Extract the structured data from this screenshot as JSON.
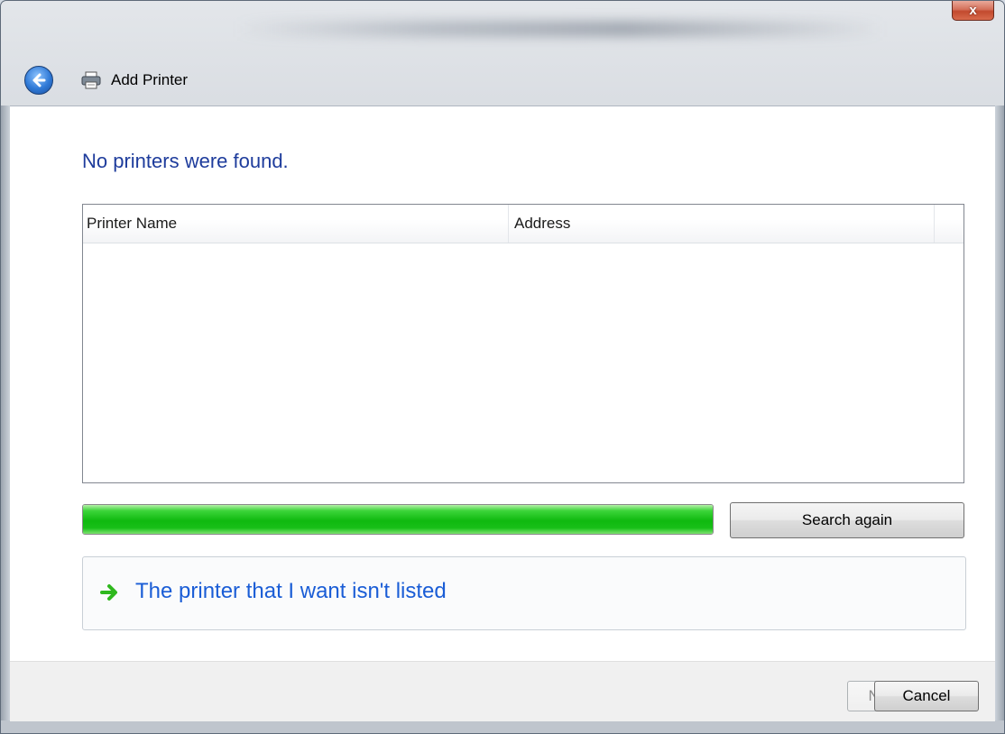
{
  "window": {
    "close_label": "x"
  },
  "nav": {
    "title": "Add Printer"
  },
  "content": {
    "heading": "No printers were found.",
    "columns": [
      "Printer Name",
      "Address"
    ],
    "progress": 1.0,
    "search_again_label": "Search again",
    "not_listed_link": "The printer that I want isn't listed"
  },
  "footer": {
    "next_label": "Next",
    "cancel_label": "Cancel"
  },
  "colors": {
    "heading": "#1e3c9c",
    "link": "#1a5dd6",
    "progress_green": "#0fb90f",
    "arrow_green": "#2fb81e"
  },
  "icons": {
    "back": "back-arrow-icon",
    "printer": "printer-icon",
    "close": "close-icon",
    "link_arrow": "green-arrow-icon"
  }
}
